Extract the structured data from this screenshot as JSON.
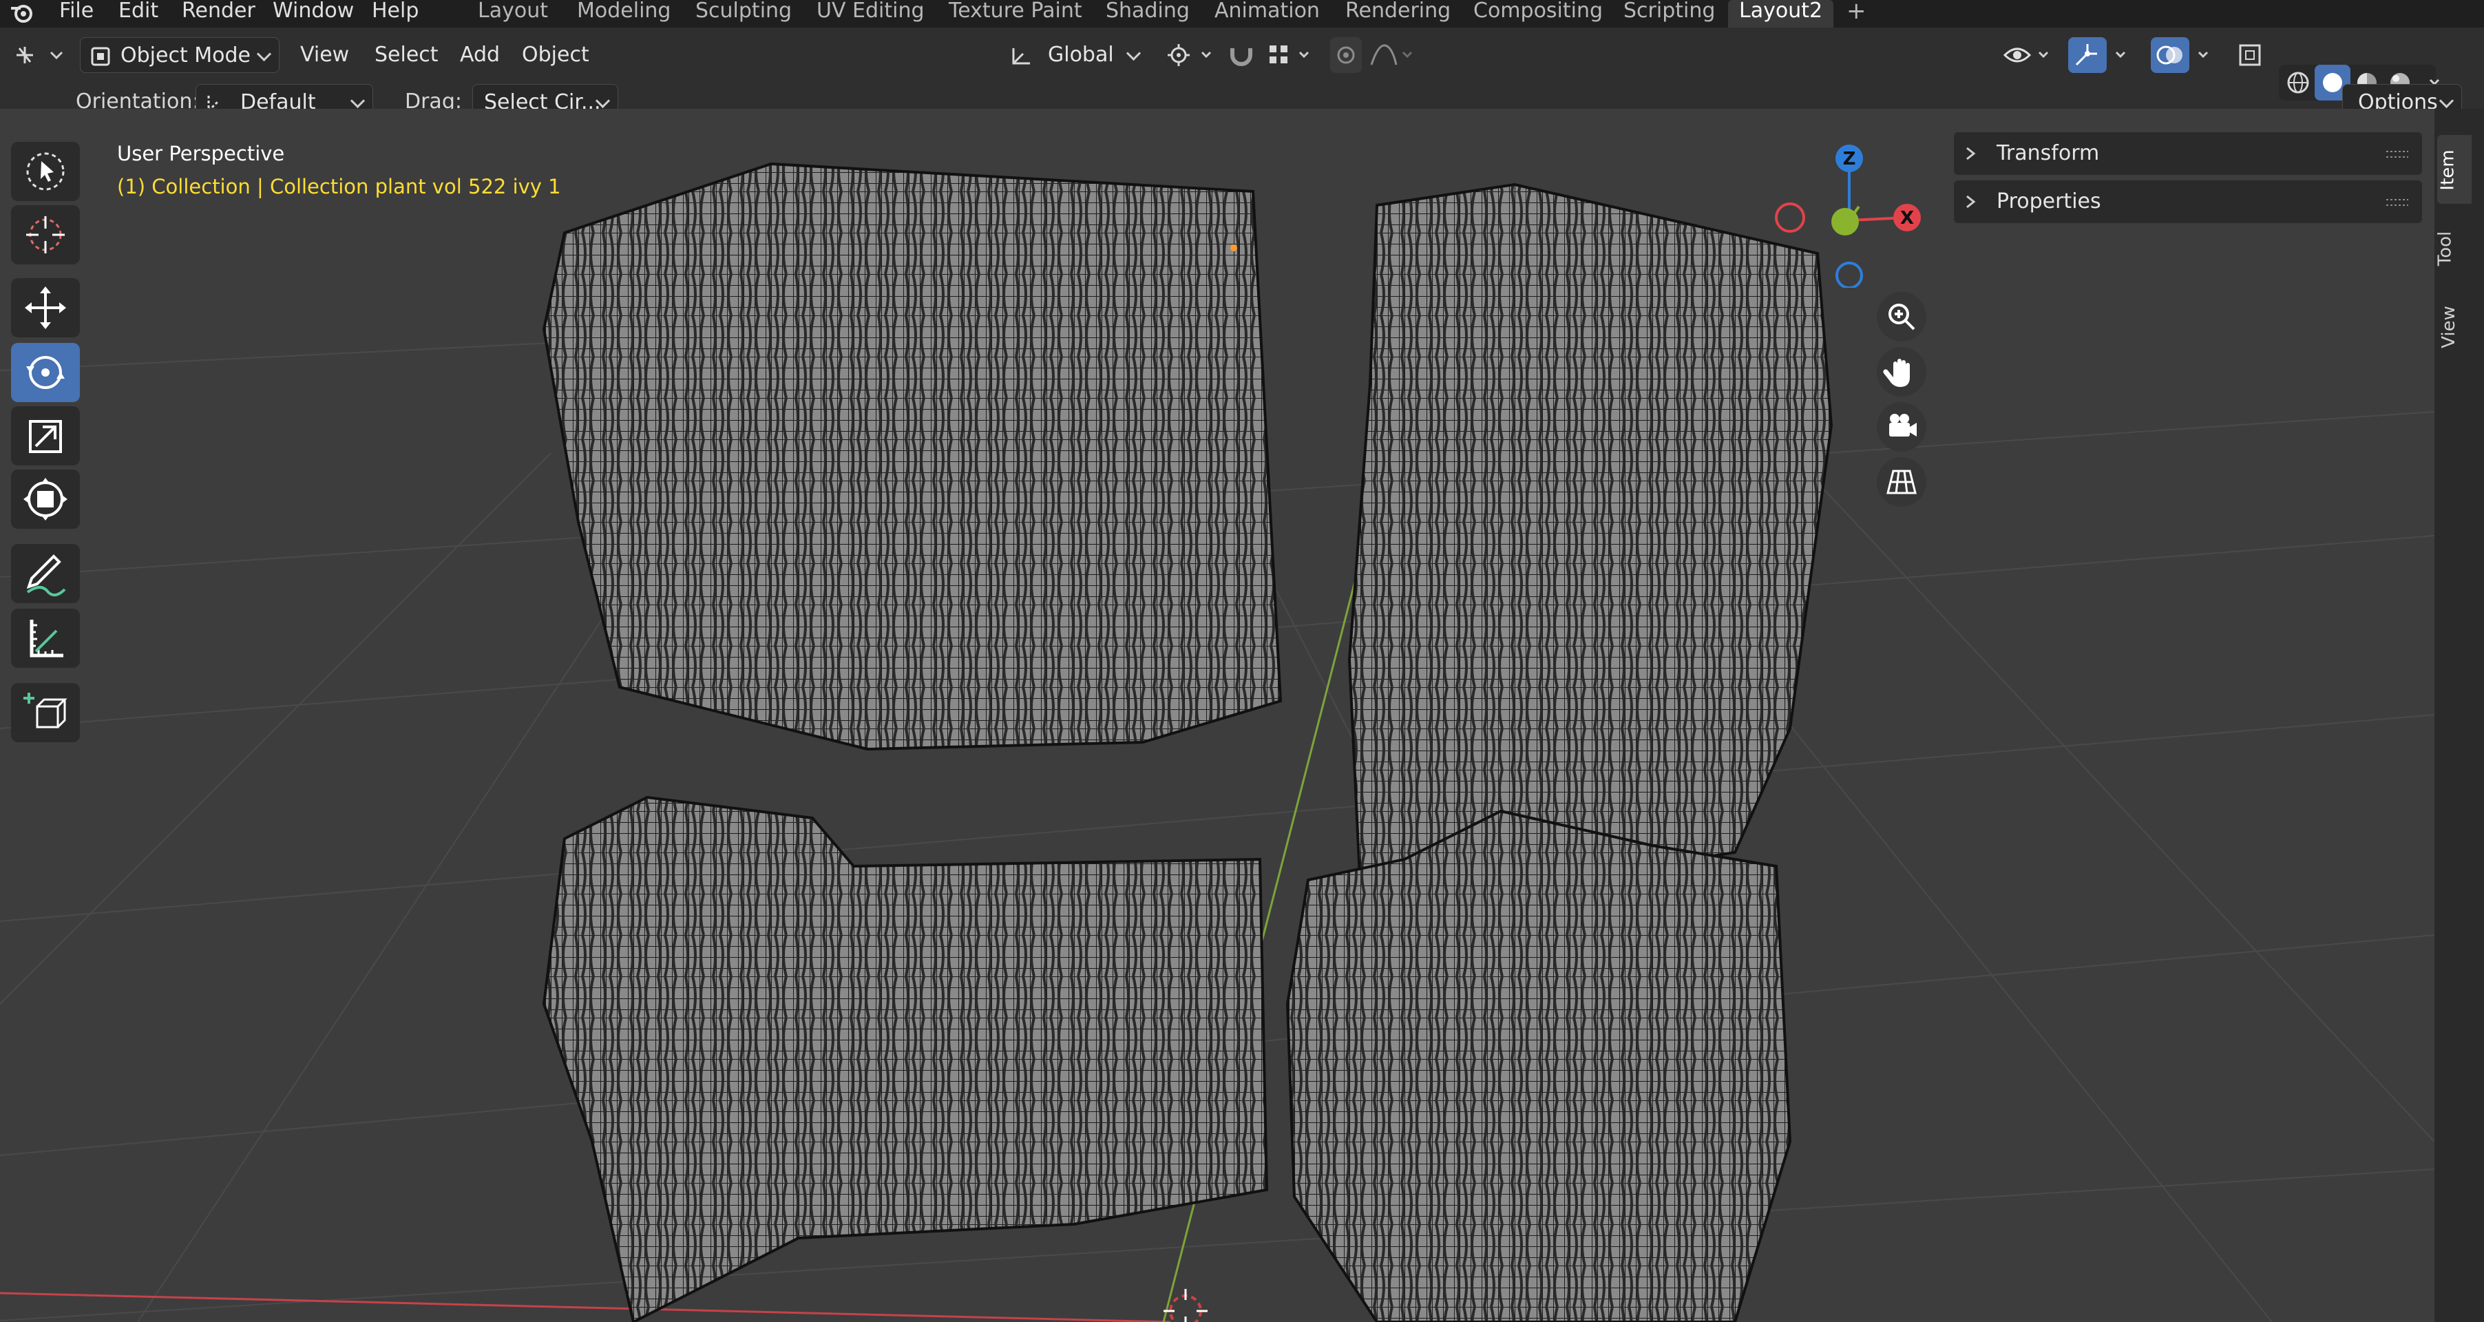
{
  "menu": {
    "items": [
      "File",
      "Edit",
      "Render",
      "Window",
      "Help"
    ]
  },
  "workspaces": {
    "tabs": [
      "Layout",
      "Modeling",
      "Sculpting",
      "UV Editing",
      "Texture Paint",
      "Shading",
      "Animation",
      "Rendering",
      "Compositing",
      "Scripting",
      "Layout2"
    ],
    "active": "Layout2",
    "add_label": "+"
  },
  "header": {
    "mode": "Object Mode",
    "menus": [
      "View",
      "Select",
      "Add",
      "Object"
    ],
    "transform_orientation": "Global",
    "options_label": "Options"
  },
  "tool_settings": {
    "orientation_label": "Orientation:",
    "orientation_value": "Default",
    "drag_label": "Drag:",
    "drag_value": "Select Cir..."
  },
  "viewport": {
    "view_name": "User Perspective",
    "collection_info": "(1) Collection | Collection plant vol 522 ivy 1"
  },
  "gizmo": {
    "z_label": "Z",
    "x_label": "X"
  },
  "sidebar": {
    "panels": [
      "Transform",
      "Properties"
    ],
    "tabs": [
      "Item",
      "Tool",
      "View"
    ]
  },
  "colors": {
    "accent": "#4772b3",
    "info_text": "#ffdd33",
    "axis_x": "#e2434b",
    "axis_y": "#8ab42e",
    "axis_z": "#2e7ed9"
  }
}
